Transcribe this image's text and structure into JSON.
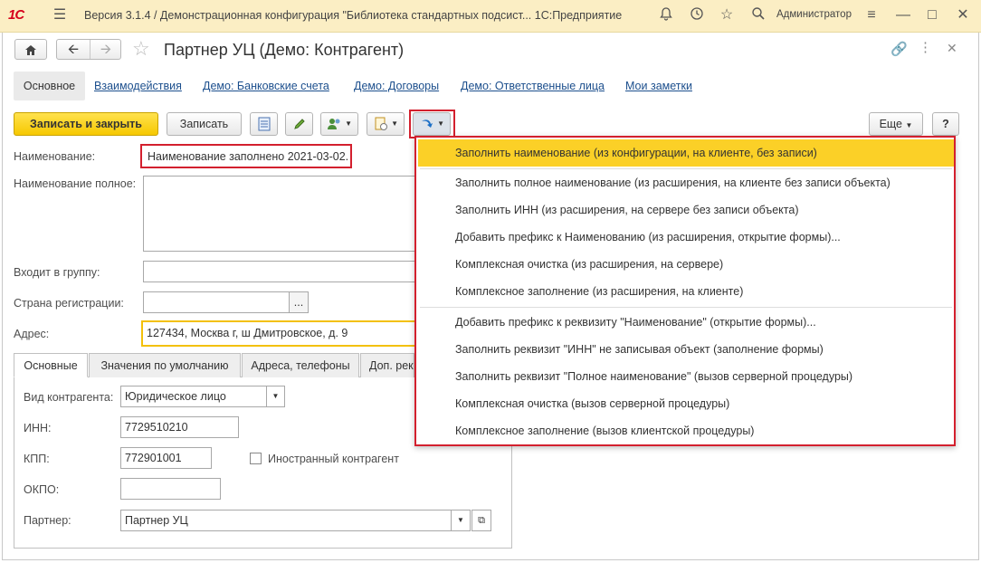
{
  "titlebar": {
    "logo": "1С",
    "title": "Версия 3.1.4 / Демонстрационная конфигурация \"Библиотека стандартных подсист...  1С:Предприятие",
    "user": "Администратор"
  },
  "window": {
    "title": "Партнер УЦ (Демо: Контрагент)"
  },
  "section_tabs": [
    "Основное",
    "Взаимодействия",
    "Демо: Банковские счета",
    "Демо: Договоры",
    "Демо: Ответственные лица",
    "Мои заметки"
  ],
  "toolbar": {
    "save_close": "Записать и закрыть",
    "save": "Записать",
    "more": "Еще",
    "help": "?"
  },
  "form": {
    "name_label": "Наименование:",
    "name_value": "Наименование заполнено 2021-03-02.",
    "full_name_label": "Наименование полное:",
    "group_label": "Входит в группу:",
    "country_label": "Страна регистрации:",
    "address_label": "Адрес:",
    "address_value": "127434, Москва г, ш Дмитровское, д. 9"
  },
  "inner_tabs": [
    "Основные",
    "Значения по умолчанию",
    "Адреса, телефоны",
    "Доп. рек"
  ],
  "details": {
    "kind_label": "Вид контрагента:",
    "kind_value": "Юридическое лицо",
    "inn_label": "ИНН:",
    "inn_value": "7729510210",
    "kpp_label": "КПП:",
    "kpp_value": "772901001",
    "foreign_label": "Иностранный контрагент",
    "okpo_label": "ОКПО:",
    "partner_label": "Партнер:",
    "partner_value": "Партнер УЦ"
  },
  "menu": {
    "group1": [
      "Заполнить наименование (из конфигурации, на клиенте, без записи)",
      "Заполнить полное наименование (из расширения, на клиенте без записи объекта)",
      "Заполнить ИНН (из расширения, на сервере без записи объекта)",
      "Добавить префикс к Наименованию (из расширения, открытие формы)...",
      "Комплексная очистка (из расширения, на сервере)",
      "Комплексное заполнение (из расширения, на клиенте)"
    ],
    "group2": [
      "Добавить префикс к реквизиту \"Наименование\" (открытие формы)...",
      "Заполнить реквизит \"ИНН\" не записывая объект (заполнение формы)",
      "Заполнить реквизит \"Полное наименование\" (вызов серверной процедуры)",
      "Комплексная очистка (вызов серверной процедуры)",
      "Комплексное заполнение (вызов клиентской процедуры)"
    ]
  },
  "colors": {
    "accent_yellow": "#f6c800",
    "highlight_red": "#d3202e",
    "titlebar_bg": "#fbeec4",
    "link_blue": "#1c4f8d"
  }
}
